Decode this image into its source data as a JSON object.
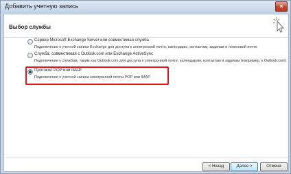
{
  "window": {
    "title": "Добавить учетную запись",
    "close_glyph": "×"
  },
  "header": {
    "title": "Выбор службы"
  },
  "options": [
    {
      "label": "Сервер Microsoft Exchange Server или совместимая служба",
      "description": "Подключение к учетной записи Exchange для доступа к электронной почте, календарю, контактам, задачам и голосовой почте",
      "selected": false
    },
    {
      "label": "Служба, совместимая с Outlook.com или Exchange ActiveSync",
      "description": "Подключение к службам, таким как Outlook.com для доступа к электронной почте, календарям, контактам и задачам (например, к Outlook.com)",
      "selected": false
    },
    {
      "label": "Протокол POP или IMAP",
      "description": "Подключение к учетной записи электронной почты POP или IMAP",
      "selected": true
    }
  ],
  "buttons": {
    "back": "< Назад",
    "next": "Далее >",
    "cancel": "Отмена"
  },
  "colors": {
    "highlight": "#e0161b",
    "accent": "#3c7fb1"
  }
}
